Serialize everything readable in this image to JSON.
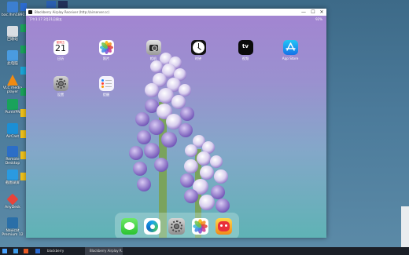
{
  "window": {
    "title": "Blackberry Airplay Receiver (http://airserver.cc)",
    "minimize": "—",
    "maximize": "☐",
    "close": "✕"
  },
  "ipad_status": {
    "time_date": "下午1:17  2月21日周五",
    "battery": "92%"
  },
  "home_apps": [
    {
      "label": "日历",
      "icon": "calendar-icon",
      "day_header": "星期五",
      "day": "21"
    },
    {
      "label": "照片",
      "icon": "photos-icon"
    },
    {
      "label": "相机",
      "icon": "camera-icon"
    },
    {
      "label": "时钟",
      "icon": "clock-icon"
    },
    {
      "label": "视频",
      "icon": "apple-tv-icon",
      "tile_text": "tv"
    },
    {
      "label": "App Store",
      "icon": "app-store-icon"
    },
    {
      "label": "设置",
      "icon": "settings-icon"
    },
    {
      "label": "提醒",
      "icon": "reminders-icon"
    }
  ],
  "dock_apps": [
    {
      "icon": "messages-icon"
    },
    {
      "icon": "edge-icon"
    },
    {
      "icon": "settings-icon"
    },
    {
      "icon": "photos-icon"
    },
    {
      "icon": "game-app-icon"
    }
  ],
  "desktop_icons": [
    {
      "label": "bac.lhm1891...",
      "icon": "computer-icon",
      "color": "#3c7fd0"
    },
    {
      "label": "回收站",
      "icon": "recycle-bin-icon",
      "color": "#d8dde3"
    },
    {
      "label": "此电脑",
      "icon": "this-pc-icon",
      "color": "#4a9be0"
    },
    {
      "label": "VLC media player",
      "icon": "vlc-icon",
      "color": "#f08a12"
    },
    {
      "label": "PureVPN",
      "icon": "purevpn-icon",
      "color": "#19a35b"
    },
    {
      "label": "AirCast",
      "icon": "aircast-icon",
      "color": "#1b8fd6"
    },
    {
      "label": "Remote Desktop",
      "icon": "remote-desktop-icon",
      "color": "#2c6ec7"
    },
    {
      "label": "截图录屏",
      "icon": "screen-capture-icon",
      "color": "#2a9ae0"
    },
    {
      "label": "AnyDesk",
      "icon": "anydesk-icon",
      "color": "#e8433a"
    },
    {
      "label": "Navicat Premium 12",
      "icon": "navicat-icon",
      "color": "#2a6fa8"
    }
  ],
  "taskbar": {
    "items": [
      "blackberry",
      "Blackberry Airplay R..."
    ]
  }
}
